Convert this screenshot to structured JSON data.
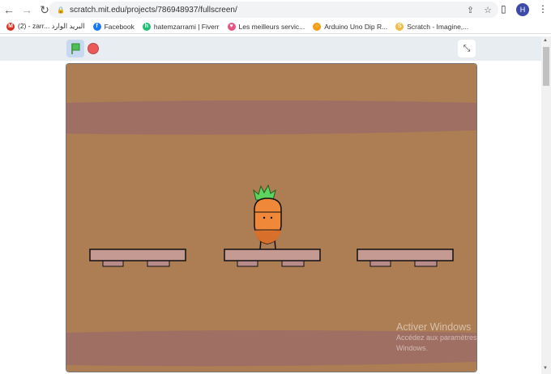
{
  "browser": {
    "url": "scratch.mit.edu/projects/786948937/fullscreen/",
    "profile_initial": "H"
  },
  "bookmarks": [
    {
      "label": "(2) - zarr... البريد الوارد",
      "icon": "gmail-icon",
      "color": "#d93025",
      "glyph": "M"
    },
    {
      "label": "Facebook",
      "icon": "facebook-icon",
      "color": "#1877f2",
      "glyph": "f"
    },
    {
      "label": "hatemzarrami | Fiverr",
      "icon": "fiverr-icon",
      "color": "#1dbf73",
      "glyph": "h"
    },
    {
      "label": "Les meilleurs servic...",
      "icon": "gift-icon",
      "color": "#e75480",
      "glyph": "♥"
    },
    {
      "label": "Arduino Uno Dip R...",
      "icon": "arduino-icon",
      "color": "#f39c12",
      "glyph": "○"
    },
    {
      "label": "Scratch - Imagine,...",
      "icon": "scratch-icon",
      "color": "#f4b942",
      "glyph": "S"
    }
  ],
  "watermark": {
    "title": "Activer Windows",
    "line": "Accédez aux paramètres pour activer Windows."
  },
  "colors": {
    "stage_bg": "#ad7e54",
    "band": "#a06f63"
  }
}
